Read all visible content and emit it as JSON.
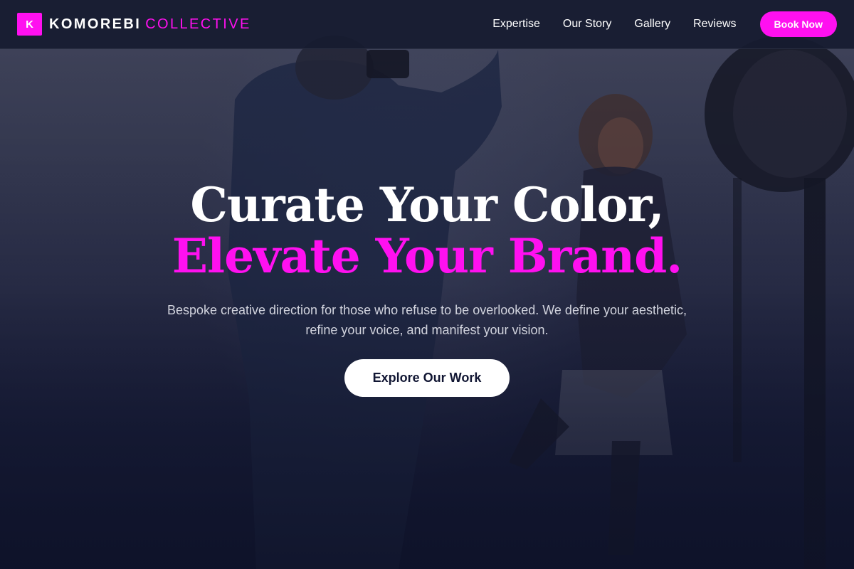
{
  "brand": {
    "mark": "K",
    "name": "KOMOREBI",
    "accent": "COLLECTIVE"
  },
  "nav": {
    "links": [
      "Expertise",
      "Our Story",
      "Gallery",
      "Reviews"
    ],
    "book_label": "Book Now"
  },
  "hero": {
    "headline_line1": "Curate Your Color,",
    "headline_line2": "Elevate Your Brand.",
    "subtitle": "Bespoke creative direction for those who refuse to be overlooked. We define your aesthetic, refine your voice, and manifest your vision.",
    "cta_label": "Explore Our Work"
  },
  "colors": {
    "accent": "#ff10f0",
    "navbar": "#161b30",
    "background": "#111633"
  }
}
